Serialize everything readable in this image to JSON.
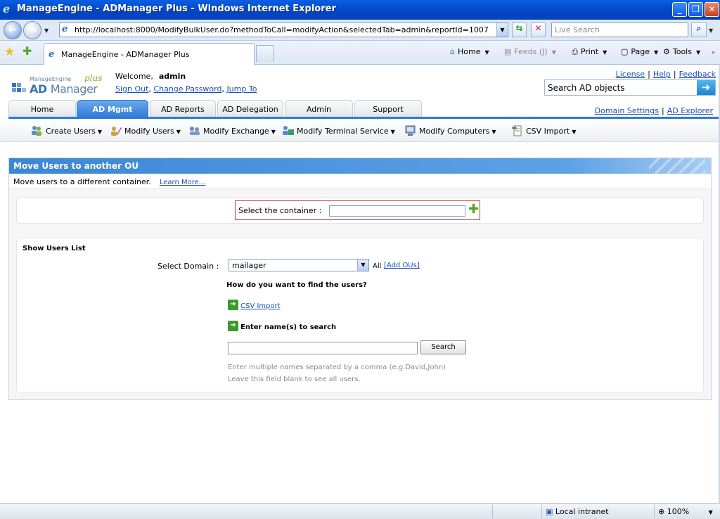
{
  "window": {
    "title": "ManageEngine - ADManager Plus - Windows Internet Explorer",
    "url": "http://localhost:8000/ModifyBulkUser.do?methodToCall=modifyAction&selectedTab=admin&reportId=1007",
    "live_search_placeholder": "Live Search",
    "tab_title": "ManageEngine - ADManager Plus",
    "commands": {
      "home": "Home",
      "feeds": "Feeds (J)",
      "print": "Print",
      "page": "Page",
      "tools": "Tools"
    }
  },
  "header": {
    "logo": {
      "vendor": "ManageEngine",
      "product_ad": "AD",
      "product_manager": "Manager",
      "plus": "plus"
    },
    "welcome_label": "Welcome,",
    "username": "admin",
    "user_links": {
      "sign_out": "Sign Out",
      "change_password": "Change Password",
      "jump_to": "Jump To"
    },
    "top_links": {
      "license": "License",
      "help": "Help",
      "feedback": "Feedback"
    },
    "search_placeholder": "Search AD objects",
    "right_links": {
      "domain_settings": "Domain Settings",
      "ad_explorer": "AD Explorer"
    }
  },
  "tabs": [
    {
      "label": "Home",
      "active": false
    },
    {
      "label": "AD Mgmt",
      "active": true
    },
    {
      "label": "AD Reports",
      "active": false
    },
    {
      "label": "AD Delegation",
      "active": false
    },
    {
      "label": "Admin",
      "active": false
    },
    {
      "label": "Support",
      "active": false
    }
  ],
  "subnav": [
    {
      "label": "Create Users",
      "icon": "users-add-icon"
    },
    {
      "label": "Modify Users",
      "icon": "user-edit-icon"
    },
    {
      "label": "Modify Exchange",
      "icon": "exchange-icon"
    },
    {
      "label": "Modify Terminal Service",
      "icon": "terminal-service-icon"
    },
    {
      "label": "Modify Computers",
      "icon": "computer-icon"
    },
    {
      "label": "CSV Import",
      "icon": "csv-import-icon"
    }
  ],
  "panel": {
    "title": "Move Users to another OU",
    "description": "Move users to a different container.",
    "learn_more": "Learn More...",
    "container_label": "Select the container :",
    "container_value": "",
    "users_list": {
      "heading": "Show Users List",
      "domain_label": "Select Domain :",
      "domain_value": "mailager",
      "all_label": "All",
      "add_ous": "[Add OUs]",
      "question": "How do you want to find the users?",
      "csv_import": "CSV Import",
      "enter_names": "Enter name(s) to search",
      "search_value": "",
      "search_button": "Search",
      "hint_line1": "Enter multiple names separated by a comma (e.g.David,John)",
      "hint_line2": "Leave this field blank to see all users."
    }
  },
  "statusbar": {
    "zone": "Local intranet",
    "zoom": "100%"
  }
}
